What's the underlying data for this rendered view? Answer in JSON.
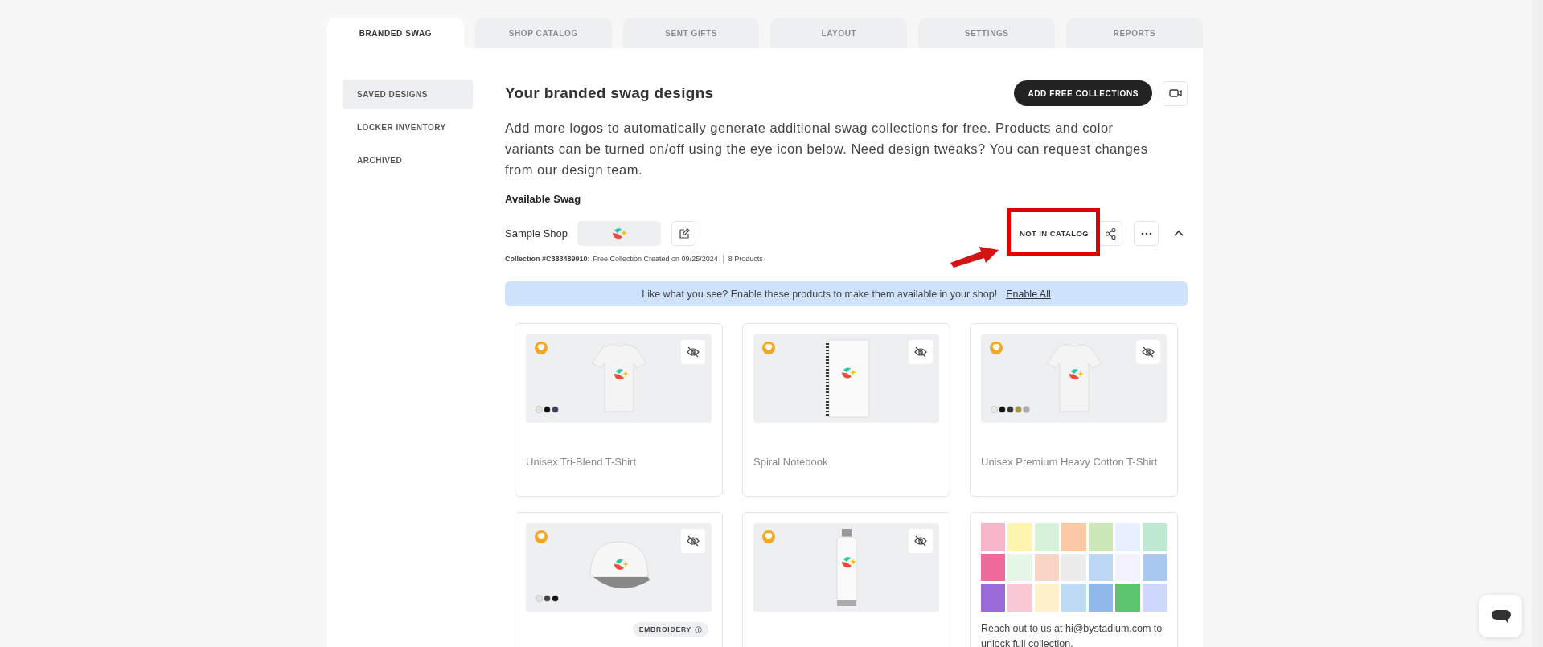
{
  "tabs": [
    {
      "label": "BRANDED SWAG",
      "selected": true
    },
    {
      "label": "SHOP CATALOG",
      "selected": false
    },
    {
      "label": "SENT GIFTS",
      "selected": false
    },
    {
      "label": "LAYOUT",
      "selected": false
    },
    {
      "label": "SETTINGS",
      "selected": false
    },
    {
      "label": "REPORTS",
      "selected": false
    }
  ],
  "sidebar": {
    "items": [
      {
        "label": "SAVED DESIGNS",
        "selected": true
      },
      {
        "label": "LOCKER INVENTORY",
        "selected": false
      },
      {
        "label": "ARCHIVED",
        "selected": false
      }
    ]
  },
  "header": {
    "title": "Your branded swag designs",
    "button": "ADD FREE COLLECTIONS",
    "description": "Add more logos to automatically generate additional swag collections for free. Products and color variants can be turned on/off using the eye icon below. Need design tweaks? You can request changes from our design team."
  },
  "section_title": "Available Swag",
  "collection": {
    "name": "Sample Shop",
    "status": "NOT IN CATALOG",
    "status_highlighted": true,
    "expanded": true,
    "id_label": "Collection #C383489910:",
    "created": "Free Collection Created on 09/25/2024",
    "count": "8 Products"
  },
  "banner": {
    "text": "Like what you see? Enable these products to make them available in your shop!",
    "link": "Enable All"
  },
  "cards": [
    {
      "kind": "tshirt",
      "title": "Unisex Tri-Blend T-Shirt",
      "hidden": true,
      "swatches": [
        {
          "color": "#e0e0e0"
        },
        {
          "color": "#111111"
        },
        {
          "color": "#3b3f6b"
        }
      ]
    },
    {
      "kind": "notebook",
      "title": "Spiral Notebook",
      "hidden": true
    },
    {
      "kind": "tshirt",
      "title": "Unisex Premium Heavy Cotton T-Shirt",
      "hidden": true,
      "swatches": [
        {
          "color": "#e6e6e6"
        },
        {
          "color": "#111111"
        },
        {
          "color": "#333333"
        },
        {
          "color": "#a8943f"
        },
        {
          "color": "#aaaaaa"
        }
      ]
    },
    {
      "kind": "cap",
      "hidden": true,
      "tag": "EMBROIDERY",
      "swatches": [
        {
          "color": "#e0e0e0"
        },
        {
          "color": "#444444"
        },
        {
          "color": "#111111"
        }
      ]
    },
    {
      "kind": "bottle",
      "hidden": true
    },
    {
      "kind": "promo",
      "text": "Reach out to us at hi@bystadium.com to unlock full collection."
    }
  ]
}
